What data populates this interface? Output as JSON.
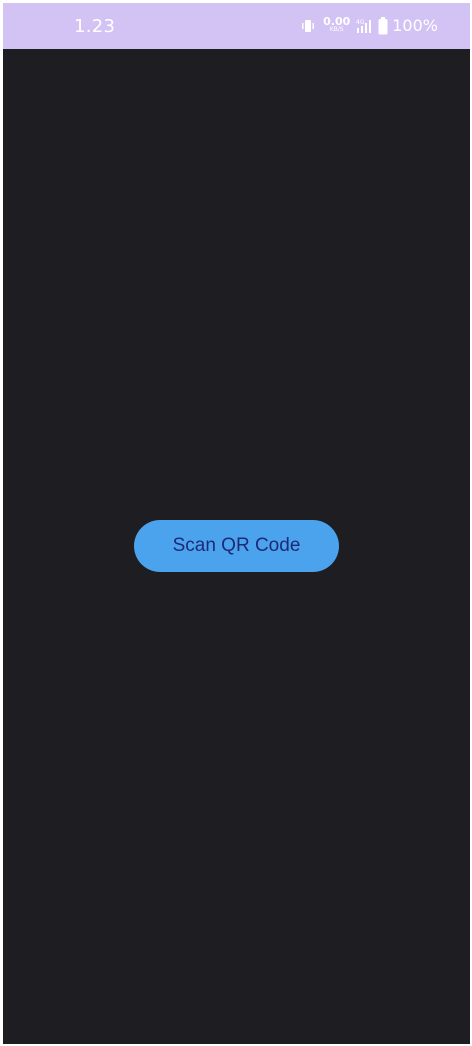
{
  "status_bar": {
    "time": "1.23",
    "net_speed_value": "0.00",
    "net_speed_unit": "KB/S",
    "network_type": "4G",
    "battery": "100%",
    "background_color": "#d3c3f4"
  },
  "main": {
    "scan_button_label": "Scan QR Code",
    "background_color": "#1e1d22",
    "button_color": "#4aa3ec",
    "button_text_color": "#1e2a78"
  },
  "icons": [
    "vibrate-icon",
    "signal-icon",
    "battery-icon"
  ]
}
